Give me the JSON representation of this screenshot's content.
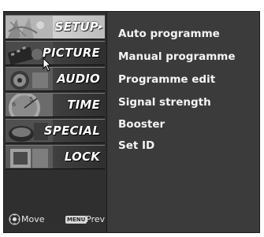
{
  "menu": {
    "items": [
      {
        "label": "SETUP",
        "icon": "setup-thumbnail-icon",
        "selected": true
      },
      {
        "label": "PICTURE",
        "icon": "picture-thumbnail-icon",
        "selected": false
      },
      {
        "label": "AUDIO",
        "icon": "audio-thumbnail-icon",
        "selected": false
      },
      {
        "label": "TIME",
        "icon": "clock-thumbnail-icon",
        "selected": false
      },
      {
        "label": "SPECIAL",
        "icon": "special-thumbnail-icon",
        "selected": false
      },
      {
        "label": "LOCK",
        "icon": "lock-thumbnail-icon",
        "selected": false
      }
    ]
  },
  "submenu": {
    "items": [
      {
        "label": "Auto programme"
      },
      {
        "label": "Manual programme"
      },
      {
        "label": "Programme edit"
      },
      {
        "label": "Signal strength"
      },
      {
        "label": "Booster"
      },
      {
        "label": "Set ID"
      }
    ]
  },
  "footer": {
    "move_icon": "navigation-pad-icon",
    "move_label": "Move",
    "menu_key": "MENU",
    "prev_label": "Prev"
  },
  "colors": {
    "background": "#3b3b3b",
    "selected_highlight": "#c8c8c8",
    "text": "#f4f4f4"
  }
}
